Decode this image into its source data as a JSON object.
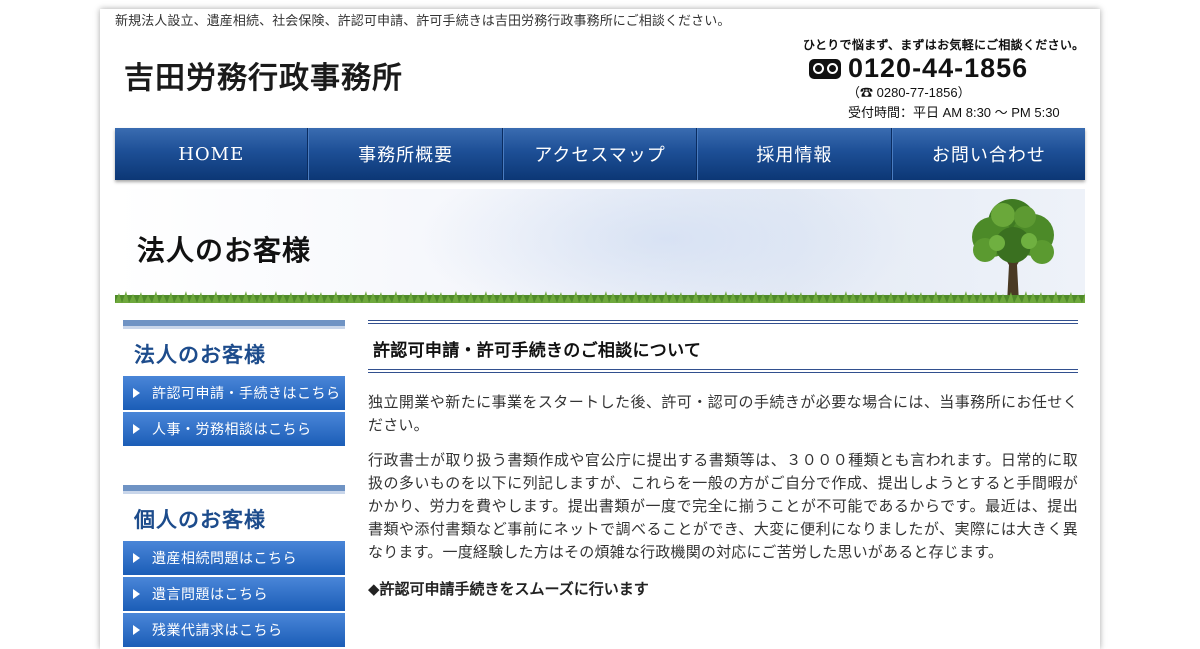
{
  "header": {
    "tagline": "新規法人設立、遺産相続、社会保険、許認可申請、許可手続きは吉田労務行政事務所にご相談ください。",
    "logo_text": "吉田労務行政事務所",
    "contact": {
      "catchphrase": "ひとりで悩まず、まずはお気軽にご相談ください。",
      "freedial_icon": "freedial-icon",
      "phone": "0120-44-1856",
      "sub_phone": "（☎ 0280-77-1856）",
      "hours": "受付時間：平日 AM 8:30 〜 PM 5:30"
    }
  },
  "nav": {
    "items": [
      {
        "label": "HOME"
      },
      {
        "label": "事務所概要"
      },
      {
        "label": "アクセスマップ"
      },
      {
        "label": "採用情報"
      },
      {
        "label": "お問い合わせ"
      }
    ]
  },
  "hero": {
    "title": "法人のお客様"
  },
  "sidebar": {
    "sections": [
      {
        "title": "法人のお客様",
        "links": [
          {
            "label": "許認可申請・手続きはこちら"
          },
          {
            "label": "人事・労務相談はこちら"
          }
        ]
      },
      {
        "title": "個人のお客様",
        "links": [
          {
            "label": "遺産相続問題はこちら"
          },
          {
            "label": "遺言問題はこちら"
          },
          {
            "label": "残業代請求はこちら"
          }
        ]
      }
    ]
  },
  "main": {
    "heading": "許認可申請・許可手続きのご相談について",
    "paragraphs": [
      "独立開業や新たに事業をスタートした後、許可・認可の手続きが必要な場合には、当事務所にお任せください。",
      "行政書士が取り扱う書類作成や官公庁に提出する書類等は、３０００種類とも言われます。日常的に取扱の多いものを以下に列記しますが、これらを一般の方がご自分で作成、提出しようとすると手間暇がかかり、労力を費やします。提出書類が一度で完全に揃うことが不可能であるからです。最近は、提出書類や添付書類など事前にネットで調べることができ、大変に便利になりましたが、実際には大きく異なります。一度経験した方はその煩雑な行政機関の対応にご苦労した思いがあると存じます。"
    ],
    "subheading": "◆許認可申請手続きをスムーズに行います"
  },
  "colors": {
    "nav_blue": "#1d4f96",
    "sidebar_button_blue": "#2a6ac4",
    "heading_blue": "#1d4c8c"
  }
}
